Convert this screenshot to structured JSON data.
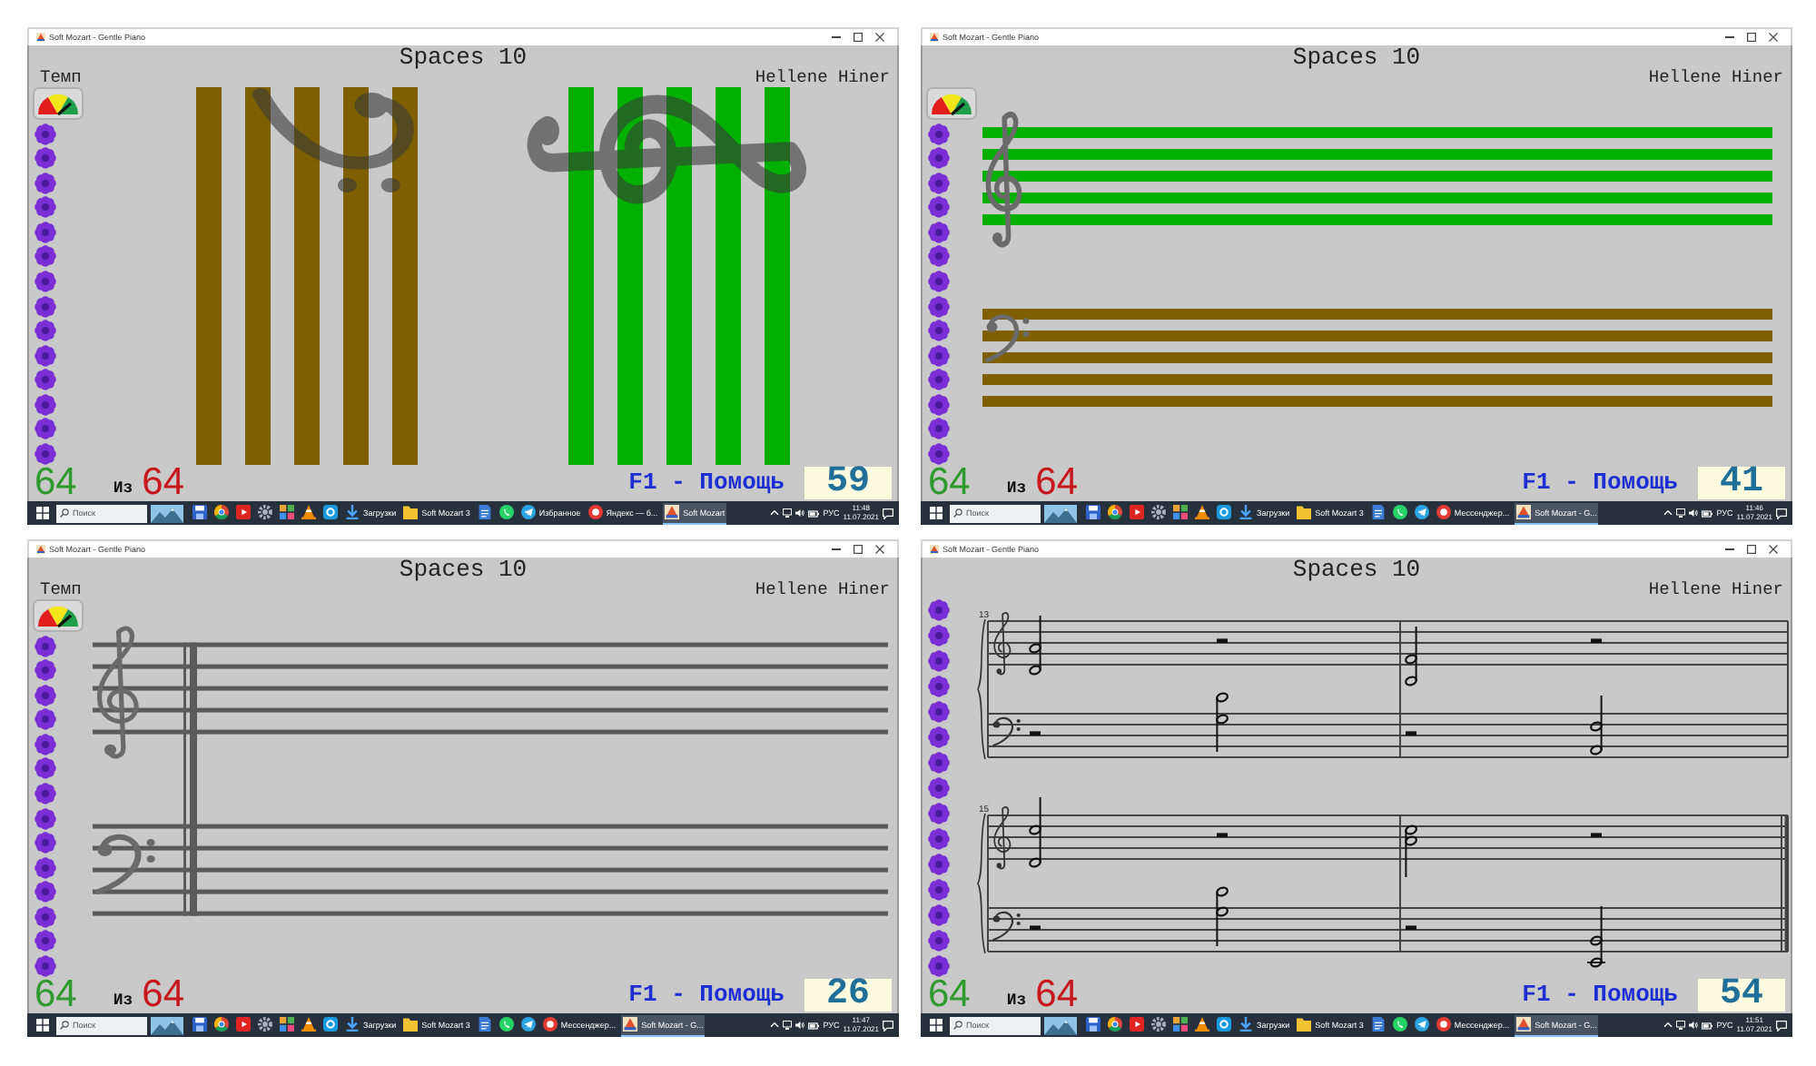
{
  "screens": [
    {
      "window": {
        "title": "Soft Mozart - Gentle Piano"
      },
      "header": {
        "title": "Spaces 10",
        "tempo_label": "Темп",
        "student": "Hellene Hiner"
      },
      "tempo_dial": true,
      "kind": "bars",
      "staves": [
        {
          "kind": "bass",
          "color": "#7f6000"
        },
        {
          "kind": "treble",
          "color": "#00b000"
        }
      ],
      "footer": {
        "correct": "64",
        "of_label": "Из",
        "total": "64",
        "help": "F1 - Помощь",
        "score": "59"
      },
      "taskbar": {
        "search": {
          "placeholder": "Поиск"
        },
        "apps": [
          {
            "kind": "floppy",
            "selected": false
          },
          {
            "kind": "wheel",
            "selected": false
          },
          {
            "kind": "play",
            "selected": false
          },
          {
            "kind": "gear",
            "selected": false
          },
          {
            "kind": "blocks",
            "selected": false
          },
          {
            "kind": "cone",
            "selected": false
          },
          {
            "kind": "tile",
            "selected": false
          },
          {
            "kind": "download",
            "label": "Загрузки",
            "selected": false
          },
          {
            "kind": "folder",
            "label": "Soft Mozart 3",
            "selected": false
          },
          {
            "kind": "document",
            "selected": false
          },
          {
            "kind": "phone",
            "selected": false
          },
          {
            "kind": "plane",
            "label": "Избранное",
            "selected": false
          },
          {
            "kind": "round",
            "label": "Яндекс — б...",
            "selected": false
          },
          {
            "kind": "app",
            "label": "Soft Mozart",
            "selected": true
          }
        ],
        "tray": {
          "language": "РУС",
          "time": "11:48",
          "date": "11.07.2021"
        }
      }
    },
    {
      "window": {
        "title": "Soft Mozart - Gentle Piano"
      },
      "header": {
        "title": "Spaces 10",
        "student": "Hellene Hiner"
      },
      "tempo_dial": true,
      "kind": "lines",
      "staves": [
        {
          "kind": "treble",
          "color": "#00b000"
        },
        {
          "kind": "bass",
          "color": "#7f6000"
        }
      ],
      "footer": {
        "correct": "64",
        "of_label": "Из",
        "total": "64",
        "help": "F1 - Помощь",
        "score": "41"
      },
      "taskbar": {
        "search": {
          "placeholder": "Поиск"
        },
        "apps": [
          {
            "kind": "floppy",
            "selected": false
          },
          {
            "kind": "wheel",
            "selected": false
          },
          {
            "kind": "play",
            "selected": false
          },
          {
            "kind": "gear",
            "selected": false
          },
          {
            "kind": "blocks",
            "selected": false
          },
          {
            "kind": "cone",
            "selected": false
          },
          {
            "kind": "tile",
            "selected": false
          },
          {
            "kind": "download",
            "label": "Загрузки",
            "selected": false
          },
          {
            "kind": "folder",
            "label": "Soft Mozart 3",
            "selected": false
          },
          {
            "kind": "document",
            "selected": false
          },
          {
            "kind": "phone",
            "selected": false
          },
          {
            "kind": "plane",
            "selected": false
          },
          {
            "kind": "round",
            "label": "Мессенджер...",
            "selected": false
          },
          {
            "kind": "app",
            "label": "Soft Mozart - G...",
            "selected": true
          }
        ],
        "tray": {
          "language": "РУС",
          "time": "11:46",
          "date": "11.07.2021"
        }
      }
    },
    {
      "window": {
        "title": "Soft Mozart - Gentle Piano"
      },
      "header": {
        "title": "Spaces 10",
        "tempo_label": "Темп",
        "student": "Hellene Hiner"
      },
      "tempo_dial": true,
      "kind": "staff",
      "staves": [
        {
          "kind": "treble"
        },
        {
          "kind": "bass"
        }
      ],
      "footer": {
        "correct": "64",
        "of_label": "Из",
        "total": "64",
        "help": "F1 - Помощь",
        "score": "26"
      },
      "taskbar": {
        "search": {
          "placeholder": "Поиск"
        },
        "apps": [
          {
            "kind": "floppy",
            "selected": false
          },
          {
            "kind": "wheel",
            "selected": false
          },
          {
            "kind": "play",
            "selected": false
          },
          {
            "kind": "gear",
            "selected": false
          },
          {
            "kind": "blocks",
            "selected": false
          },
          {
            "kind": "cone",
            "selected": false
          },
          {
            "kind": "tile",
            "selected": false
          },
          {
            "kind": "download",
            "label": "Загрузки",
            "selected": false
          },
          {
            "kind": "folder",
            "label": "Soft Mozart 3",
            "selected": false
          },
          {
            "kind": "document",
            "selected": false
          },
          {
            "kind": "phone",
            "selected": false
          },
          {
            "kind": "plane",
            "selected": false
          },
          {
            "kind": "round",
            "label": "Мессенджер...",
            "selected": false
          },
          {
            "kind": "app",
            "label": "Soft Mozart - G...",
            "selected": true
          }
        ],
        "tray": {
          "language": "РУС",
          "time": "11:47",
          "date": "11.07.2021"
        }
      }
    },
    {
      "window": {
        "title": "Soft Mozart - Gentle Piano"
      },
      "header": {
        "title": "Spaces 10",
        "student": "Hellene Hiner"
      },
      "kind": "score",
      "systems": [
        {
          "measure_number": "13"
        },
        {
          "measure_number": "15"
        }
      ],
      "footer": {
        "correct": "64",
        "of_label": "Из",
        "total": "64",
        "help": "F1 - Помощь",
        "score": "54"
      },
      "taskbar": {
        "search": {
          "placeholder": "Поиск"
        },
        "apps": [
          {
            "kind": "floppy",
            "selected": false
          },
          {
            "kind": "wheel",
            "selected": false
          },
          {
            "kind": "play",
            "selected": false
          },
          {
            "kind": "gear",
            "selected": false
          },
          {
            "kind": "blocks",
            "selected": false
          },
          {
            "kind": "cone",
            "selected": false
          },
          {
            "kind": "tile",
            "selected": false
          },
          {
            "kind": "download",
            "label": "Загрузки",
            "selected": false
          },
          {
            "kind": "folder",
            "label": "Soft Mozart 3",
            "selected": false
          },
          {
            "kind": "document",
            "selected": false
          },
          {
            "kind": "phone",
            "selected": false
          },
          {
            "kind": "plane",
            "selected": false
          },
          {
            "kind": "round",
            "label": "Мессенджер...",
            "selected": false
          },
          {
            "kind": "app",
            "label": "Soft Mozart - G...",
            "selected": true
          }
        ],
        "tray": {
          "language": "РУС",
          "time": "11:51",
          "date": "11.07.2021"
        }
      }
    }
  ]
}
